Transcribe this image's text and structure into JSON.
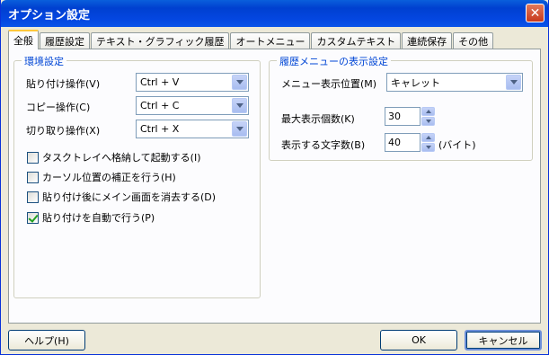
{
  "window": {
    "title": "オプション設定"
  },
  "tabs": [
    "全般",
    "履歴設定",
    "テキスト・グラフィック履歴",
    "オートメニュー",
    "カスタムテキスト",
    "連続保存",
    "その他"
  ],
  "env": {
    "title": "環境設定",
    "paste_label": "貼り付け操作(V)",
    "paste_value": "Ctrl + V",
    "copy_label": "コピー操作(C)",
    "copy_value": "Ctrl + C",
    "cut_label": "切り取り操作(X)",
    "cut_value": "Ctrl + X",
    "checkboxes": [
      {
        "label": "タスクトレイへ格納して起動する(I)",
        "checked": false
      },
      {
        "label": "カーソル位置の補正を行う(H)",
        "checked": false
      },
      {
        "label": "貼り付け後にメイン画面を消去する(D)",
        "checked": false
      },
      {
        "label": "貼り付けを自動で行う(P)",
        "checked": true
      }
    ]
  },
  "history_menu": {
    "title": "履歴メニューの表示設定",
    "pos_label": "メニュー表示位置(M)",
    "pos_value": "キャレット",
    "max_label": "最大表示個数(K)",
    "max_value": "30",
    "chars_label": "表示する文字数(B)",
    "chars_value": "40",
    "chars_unit": "(バイト)"
  },
  "buttons": {
    "help": "ヘルプ(H)",
    "ok": "OK",
    "cancel": "キャンセル"
  }
}
